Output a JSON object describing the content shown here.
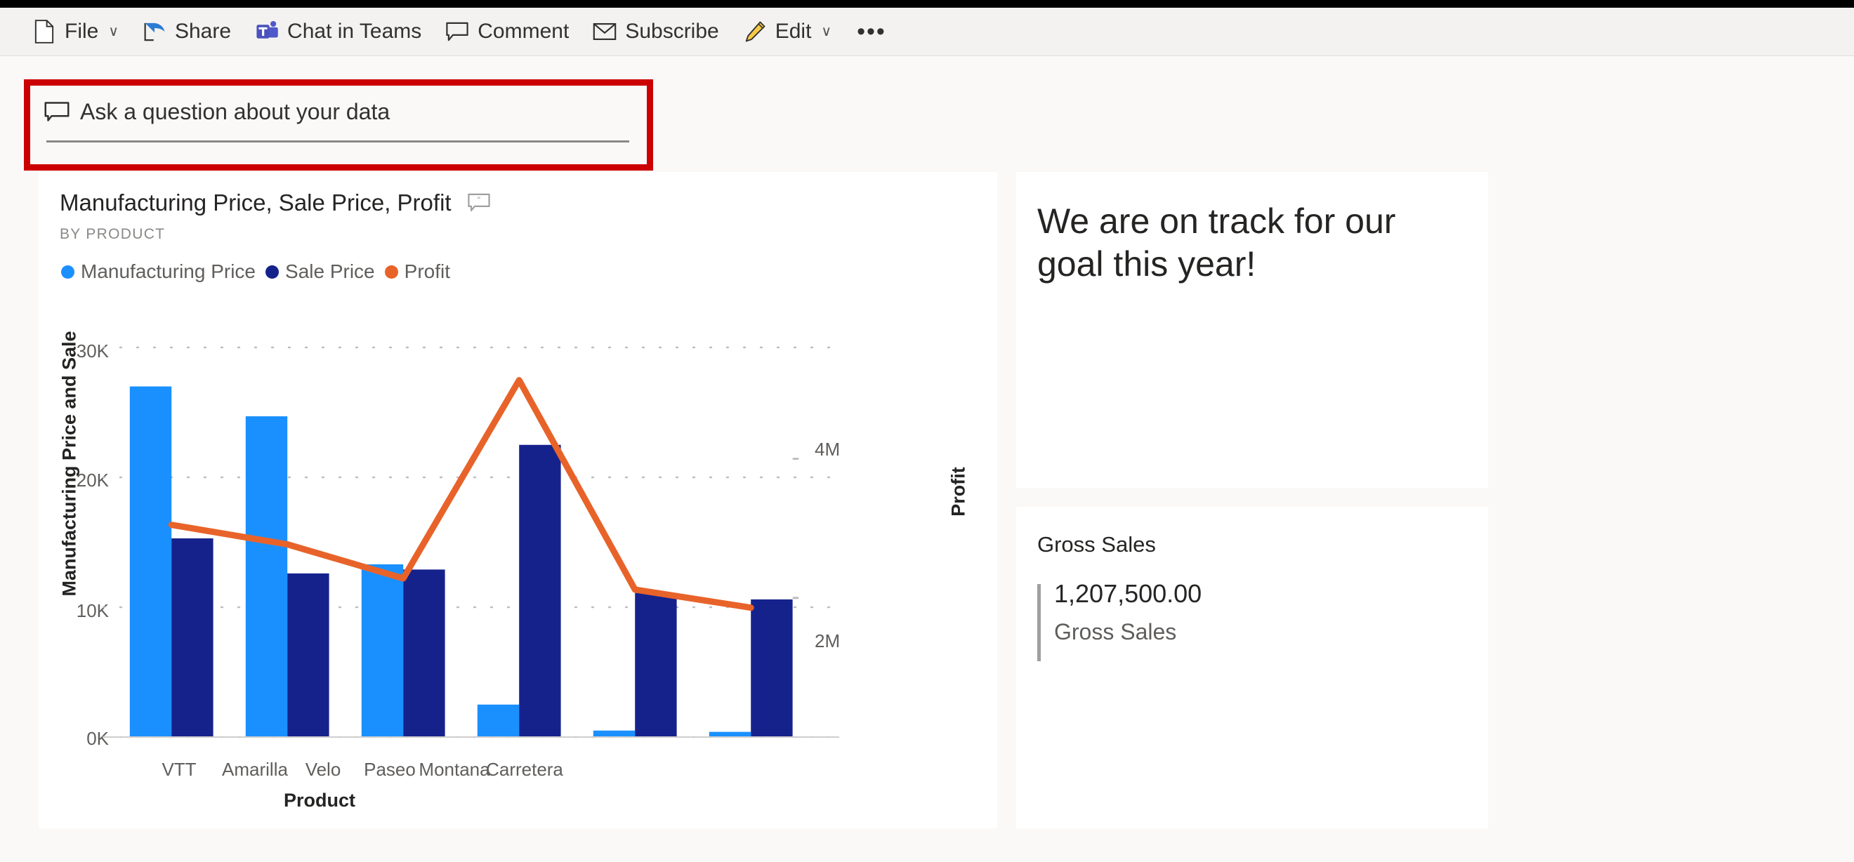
{
  "toolbar": {
    "items": [
      {
        "label": "File",
        "icon": "file-icon",
        "caret": true
      },
      {
        "label": "Share",
        "icon": "share-icon",
        "caret": false
      },
      {
        "label": "Chat in Teams",
        "icon": "teams-icon",
        "caret": false
      },
      {
        "label": "Comment",
        "icon": "comment-icon",
        "caret": false
      },
      {
        "label": "Subscribe",
        "icon": "mail-icon",
        "caret": false
      },
      {
        "label": "Edit",
        "icon": "pencil-icon",
        "caret": true
      }
    ],
    "overflow_label": "•••",
    "caret_glyph": "∨"
  },
  "qna": {
    "icon": "qna-bubble-icon",
    "placeholder": "Ask a question about your data",
    "value": "",
    "highlight_color": "#cc0000"
  },
  "chart_card": {
    "title": "Manufacturing Price, Sale Price, Profit",
    "subtitle": "BY PRODUCT",
    "qna_icon": "qna-visual-icon"
  },
  "goal_card": {
    "text": "We are on track for our goal this year!"
  },
  "kpi_card": {
    "title": "Gross Sales",
    "value": "1,207,500.00",
    "caption": "Gross Sales"
  },
  "chart_data": {
    "type": "bar",
    "title": "Manufacturing Price, Sale Price, Profit",
    "subtitle": "BY PRODUCT",
    "xlabel": "Product",
    "ylabel": "Manufacturing Price and Sale",
    "ylabel_right": "Profit",
    "categories": [
      "VTT",
      "Amarilla",
      "Velo",
      "Paseo",
      "Montana",
      "Carretera"
    ],
    "series": [
      {
        "name": "Manufacturing Price",
        "type": "bar",
        "axis": "left",
        "color": "#1a90ff",
        "values": [
          27000,
          24700,
          13300,
          2500,
          500,
          400
        ]
      },
      {
        "name": "Sale Price",
        "type": "bar",
        "axis": "left",
        "color": "#16228c",
        "values": [
          15300,
          12600,
          12900,
          22500,
          11100,
          10600
        ]
      },
      {
        "name": "Profit",
        "type": "line",
        "axis": "right",
        "color": "#e8632a",
        "values": [
          3050000,
          2770000,
          2280000,
          5130000,
          2120000,
          1860000
        ]
      }
    ],
    "ylim": [
      0,
      30000
    ],
    "yticks": [
      0,
      10000,
      20000,
      30000
    ],
    "ytick_labels": [
      "0K",
      "10K",
      "20K",
      "30K"
    ],
    "ylim_right": [
      0,
      5600000
    ],
    "yticks_right": [
      2000000,
      4000000
    ],
    "ytick_labels_right": [
      "2M",
      "4M"
    ],
    "grid": true,
    "legend_position": "top-left",
    "legend": [
      "Manufacturing Price",
      "Sale Price",
      "Profit"
    ]
  }
}
